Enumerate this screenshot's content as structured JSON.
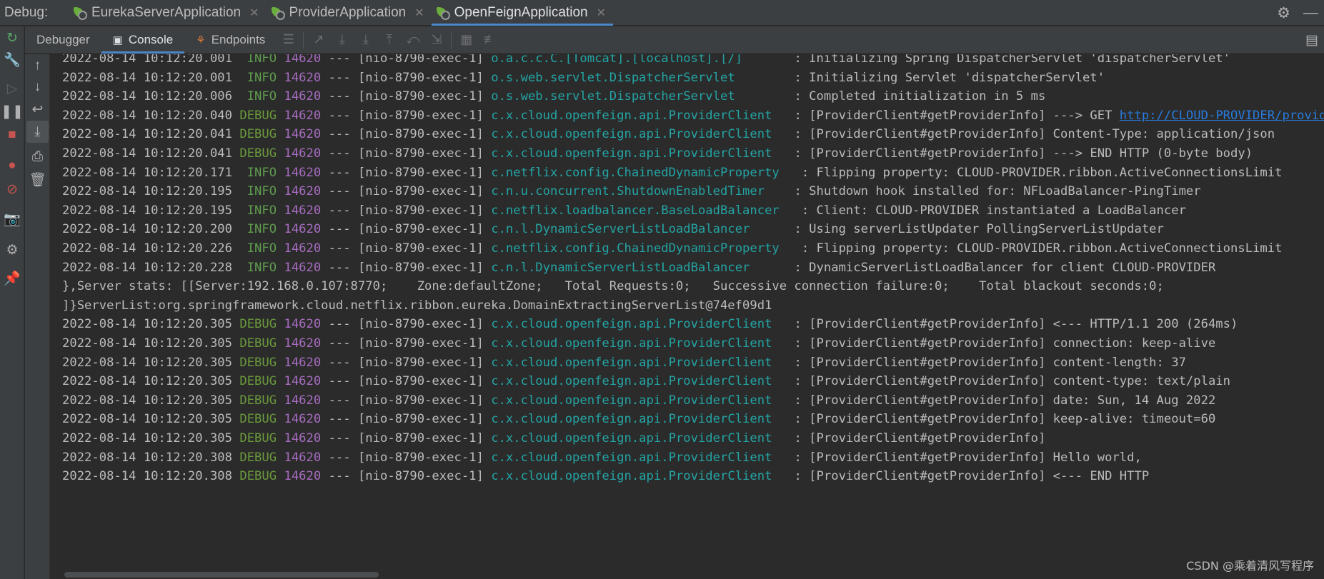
{
  "debug_label": "Debug:",
  "run_tabs": [
    {
      "label": "EurekaServerApplication",
      "active": false
    },
    {
      "label": "ProviderApplication",
      "active": false
    },
    {
      "label": "OpenFeignApplication",
      "active": true
    }
  ],
  "debugger_tabs": {
    "debugger": "Debugger",
    "console": "Console",
    "endpoints": "Endpoints"
  },
  "watermark": "CSDN @乘着清风写程序",
  "colors": {
    "accent": "#4a88c7",
    "info": "#5f9c4e",
    "debug": "#6a9a3b",
    "pid": "#a66cbf",
    "logger": "#24a4a4"
  },
  "log_lines": [
    {
      "date": "2022-08-14 10:12:20.001",
      "level": " INFO",
      "pid": "14620",
      "thread": " --- [nio-8790-exec-1] ",
      "logger": "o.a.c.c.C.[Tomcat].[localhost].[/]      ",
      "msg": " : Initializing Spring DispatcherServlet 'dispatcherServlet'",
      "link": ""
    },
    {
      "date": "2022-08-14 10:12:20.001",
      "level": " INFO",
      "pid": "14620",
      "thread": " --- [nio-8790-exec-1] ",
      "logger": "o.s.web.servlet.DispatcherServlet       ",
      "msg": " : Initializing Servlet 'dispatcherServlet'",
      "link": ""
    },
    {
      "date": "2022-08-14 10:12:20.006",
      "level": " INFO",
      "pid": "14620",
      "thread": " --- [nio-8790-exec-1] ",
      "logger": "o.s.web.servlet.DispatcherServlet       ",
      "msg": " : Completed initialization in 5 ms",
      "link": ""
    },
    {
      "date": "2022-08-14 10:12:20.040",
      "level": "DEBUG",
      "pid": "14620",
      "thread": " --- [nio-8790-exec-1] ",
      "logger": "c.x.cloud.openfeign.api.ProviderClient  ",
      "msg": " : [ProviderClient#getProviderInfo] ---> GET ",
      "link": "http://CLOUD-PROVIDER/provider/getProviderInfo"
    },
    {
      "date": "2022-08-14 10:12:20.041",
      "level": "DEBUG",
      "pid": "14620",
      "thread": " --- [nio-8790-exec-1] ",
      "logger": "c.x.cloud.openfeign.api.ProviderClient  ",
      "msg": " : [ProviderClient#getProviderInfo] Content-Type: application/json",
      "link": ""
    },
    {
      "date": "2022-08-14 10:12:20.041",
      "level": "DEBUG",
      "pid": "14620",
      "thread": " --- [nio-8790-exec-1] ",
      "logger": "c.x.cloud.openfeign.api.ProviderClient  ",
      "msg": " : [ProviderClient#getProviderInfo] ---> END HTTP (0-byte body)",
      "link": ""
    },
    {
      "date": "2022-08-14 10:12:20.171",
      "level": " INFO",
      "pid": "14620",
      "thread": " --- [nio-8790-exec-1] ",
      "logger": "c.netflix.config.ChainedDynamicProperty  ",
      "msg": " : Flipping property: CLOUD-PROVIDER.ribbon.ActiveConnectionsLimit",
      "link": ""
    },
    {
      "date": "2022-08-14 10:12:20.195",
      "level": " INFO",
      "pid": "14620",
      "thread": " --- [nio-8790-exec-1] ",
      "logger": "c.n.u.concurrent.ShutdownEnabledTimer   ",
      "msg": " : Shutdown hook installed for: NFLoadBalancer-PingTimer",
      "link": ""
    },
    {
      "date": "2022-08-14 10:12:20.195",
      "level": " INFO",
      "pid": "14620",
      "thread": " --- [nio-8790-exec-1] ",
      "logger": "c.netflix.loadbalancer.BaseLoadBalancer  ",
      "msg": " : Client: CLOUD-PROVIDER instantiated a LoadBalancer",
      "link": ""
    },
    {
      "date": "2022-08-14 10:12:20.200",
      "level": " INFO",
      "pid": "14620",
      "thread": " --- [nio-8790-exec-1] ",
      "logger": "c.n.l.DynamicServerListLoadBalancer     ",
      "msg": " : Using serverListUpdater PollingServerListUpdater",
      "link": ""
    },
    {
      "date": "2022-08-14 10:12:20.226",
      "level": " INFO",
      "pid": "14620",
      "thread": " --- [nio-8790-exec-1] ",
      "logger": "c.netflix.config.ChainedDynamicProperty  ",
      "msg": " : Flipping property: CLOUD-PROVIDER.ribbon.ActiveConnectionsLimit",
      "link": ""
    },
    {
      "date": "2022-08-14 10:12:20.228",
      "level": " INFO",
      "pid": "14620",
      "thread": " --- [nio-8790-exec-1] ",
      "logger": "c.n.l.DynamicServerListLoadBalancer     ",
      "msg": " : DynamicServerListLoadBalancer for client CLOUD-PROVIDER",
      "link": ""
    },
    {
      "plain": "},Server stats: [[Server:192.168.0.107:8770;    Zone:defaultZone;   Total Requests:0;   Successive connection failure:0;    Total blackout seconds:0;"
    },
    {
      "plain": "]}ServerList:org.springframework.cloud.netflix.ribbon.eureka.DomainExtractingServerList@74ef09d1"
    },
    {
      "date": "2022-08-14 10:12:20.305",
      "level": "DEBUG",
      "pid": "14620",
      "thread": " --- [nio-8790-exec-1] ",
      "logger": "c.x.cloud.openfeign.api.ProviderClient  ",
      "msg": " : [ProviderClient#getProviderInfo] <--- HTTP/1.1 200 (264ms)",
      "link": ""
    },
    {
      "date": "2022-08-14 10:12:20.305",
      "level": "DEBUG",
      "pid": "14620",
      "thread": " --- [nio-8790-exec-1] ",
      "logger": "c.x.cloud.openfeign.api.ProviderClient  ",
      "msg": " : [ProviderClient#getProviderInfo] connection: keep-alive",
      "link": ""
    },
    {
      "date": "2022-08-14 10:12:20.305",
      "level": "DEBUG",
      "pid": "14620",
      "thread": " --- [nio-8790-exec-1] ",
      "logger": "c.x.cloud.openfeign.api.ProviderClient  ",
      "msg": " : [ProviderClient#getProviderInfo] content-length: 37",
      "link": ""
    },
    {
      "date": "2022-08-14 10:12:20.305",
      "level": "DEBUG",
      "pid": "14620",
      "thread": " --- [nio-8790-exec-1] ",
      "logger": "c.x.cloud.openfeign.api.ProviderClient  ",
      "msg": " : [ProviderClient#getProviderInfo] content-type: text/plain",
      "link": ""
    },
    {
      "date": "2022-08-14 10:12:20.305",
      "level": "DEBUG",
      "pid": "14620",
      "thread": " --- [nio-8790-exec-1] ",
      "logger": "c.x.cloud.openfeign.api.ProviderClient  ",
      "msg": " : [ProviderClient#getProviderInfo] date: Sun, 14 Aug 2022",
      "link": ""
    },
    {
      "date": "2022-08-14 10:12:20.305",
      "level": "DEBUG",
      "pid": "14620",
      "thread": " --- [nio-8790-exec-1] ",
      "logger": "c.x.cloud.openfeign.api.ProviderClient  ",
      "msg": " : [ProviderClient#getProviderInfo] keep-alive: timeout=60",
      "link": ""
    },
    {
      "date": "2022-08-14 10:12:20.305",
      "level": "DEBUG",
      "pid": "14620",
      "thread": " --- [nio-8790-exec-1] ",
      "logger": "c.x.cloud.openfeign.api.ProviderClient  ",
      "msg": " : [ProviderClient#getProviderInfo]",
      "link": ""
    },
    {
      "date": "2022-08-14 10:12:20.308",
      "level": "DEBUG",
      "pid": "14620",
      "thread": " --- [nio-8790-exec-1] ",
      "logger": "c.x.cloud.openfeign.api.ProviderClient  ",
      "msg": " : [ProviderClient#getProviderInfo] Hello world,",
      "link": ""
    },
    {
      "date": "2022-08-14 10:12:20.308",
      "level": "DEBUG",
      "pid": "14620",
      "thread": " --- [nio-8790-exec-1] ",
      "logger": "c.x.cloud.openfeign.api.ProviderClient  ",
      "msg": " : [ProviderClient#getProviderInfo] <--- END HTTP",
      "link": ""
    }
  ]
}
